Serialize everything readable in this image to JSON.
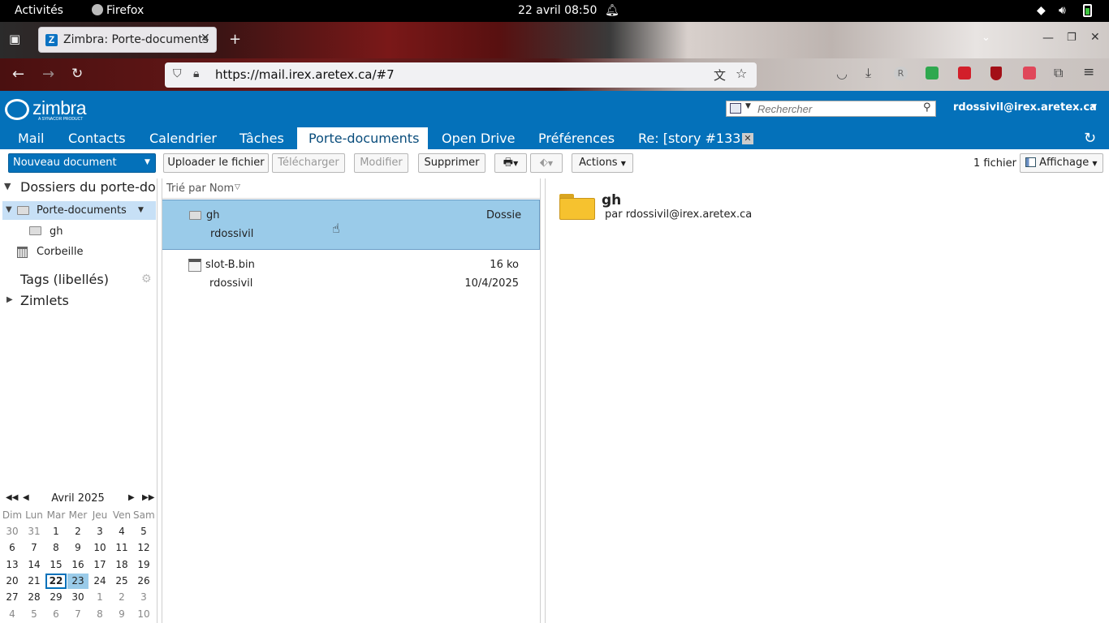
{
  "system_bar": {
    "activities": "Activités",
    "app": "Firefox",
    "datetime": "22 avril  08:50"
  },
  "browser": {
    "tab_title": "Zimbra: Porte-documents",
    "favicon_letter": "Z",
    "url": "https://mail.irex.aretex.ca/#7"
  },
  "zimbra": {
    "logo_text": "zimbra",
    "logo_sub": "A SYNACOR PRODUCT",
    "search_placeholder": "Rechercher",
    "user": "rdossivil@irex.aretex.ca",
    "tabs": [
      {
        "label": "Mail"
      },
      {
        "label": "Contacts"
      },
      {
        "label": "Calendrier"
      },
      {
        "label": "Tâches"
      },
      {
        "label": "Porte-documents"
      },
      {
        "label": "Open Drive"
      },
      {
        "label": "Préférences"
      },
      {
        "label": "Re: [story #133"
      }
    ]
  },
  "toolbar": {
    "new_doc": "Nouveau document",
    "upload": "Uploader le fichier",
    "download": "Télécharger",
    "edit": "Modifier",
    "delete": "Supprimer",
    "actions": "Actions",
    "count": "1 fichier",
    "view": "Affichage"
  },
  "sidebar": {
    "section_title": "Dossiers du porte-documents",
    "folders": [
      {
        "label": "Porte-documents"
      },
      {
        "label": "gh"
      },
      {
        "label": "Corbeille"
      }
    ],
    "tags": "Tags (libellés)",
    "zimlets": "Zimlets"
  },
  "list": {
    "sort_label": "Trié par Nom",
    "items": [
      {
        "name": "gh",
        "type": "Dossie",
        "owner": "rdossivil",
        "date": ""
      },
      {
        "name": "slot-B.bin",
        "type": "16 ko",
        "owner": "rdossivil",
        "date": "10/4/2025"
      }
    ]
  },
  "preview": {
    "title": "gh",
    "by": "par rdossivil@irex.aretex.ca"
  },
  "calendar": {
    "month": "Avril 2025",
    "weekdays": [
      "Dim",
      "Lun",
      "Mar",
      "Mer",
      "Jeu",
      "Ven",
      "Sam"
    ],
    "weeks": [
      [
        "30",
        "31",
        "1",
        "2",
        "3",
        "4",
        "5"
      ],
      [
        "6",
        "7",
        "8",
        "9",
        "10",
        "11",
        "12"
      ],
      [
        "13",
        "14",
        "15",
        "16",
        "17",
        "18",
        "19"
      ],
      [
        "20",
        "21",
        "22",
        "23",
        "24",
        "25",
        "26"
      ],
      [
        "27",
        "28",
        "29",
        "30",
        "1",
        "2",
        "3"
      ],
      [
        "4",
        "5",
        "6",
        "7",
        "8",
        "9",
        "10"
      ]
    ]
  }
}
